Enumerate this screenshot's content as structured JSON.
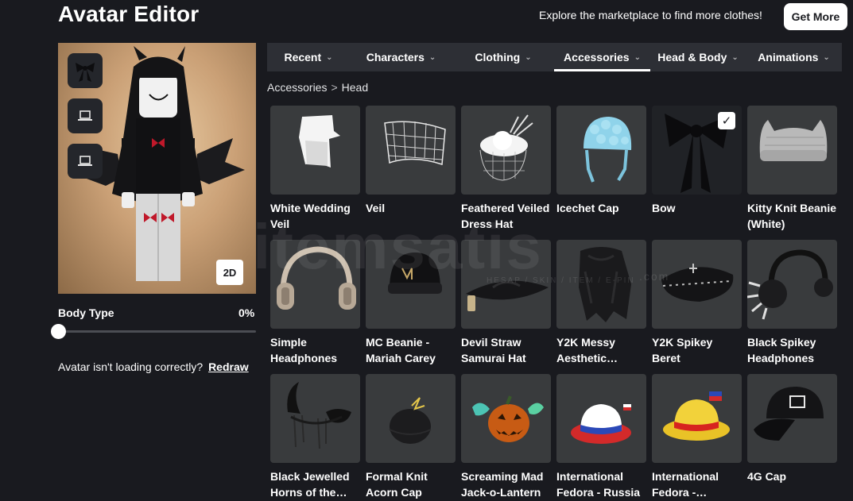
{
  "header": {
    "title": "Avatar Editor",
    "promo_text": "Explore the marketplace to find more clothes!",
    "get_more_label": "Get More"
  },
  "preview": {
    "toggle_2d_label": "2D",
    "thumb_icons": [
      "bow-icon",
      "laptop-icon",
      "laptop-icon"
    ]
  },
  "body_type": {
    "label": "Body Type",
    "value": "0%",
    "level": 0
  },
  "redraw": {
    "message": "Avatar isn't loading correctly?",
    "link": "Redraw"
  },
  "tabs": [
    {
      "label": "Recent",
      "active": false
    },
    {
      "label": "Characters",
      "active": false
    },
    {
      "label": "Clothing",
      "active": false
    },
    {
      "label": "Accessories",
      "active": true
    },
    {
      "label": "Head & Body",
      "active": false
    },
    {
      "label": "Animations",
      "active": false
    }
  ],
  "breadcrumb": {
    "parent": "Accessories",
    "separator": ">",
    "current": "Head"
  },
  "items": [
    {
      "name": "White Wedding Veil",
      "icon": "white-veil-icon",
      "selected": false
    },
    {
      "name": "Veil",
      "icon": "mesh-veil-icon",
      "selected": false
    },
    {
      "name": "Feathered Veiled Dress Hat",
      "icon": "feathered-hat-icon",
      "selected": false
    },
    {
      "name": "Icechet Cap",
      "icon": "ice-cap-icon",
      "selected": false
    },
    {
      "name": "Bow",
      "icon": "black-bow-icon",
      "selected": true
    },
    {
      "name": "Kitty Knit Beanie (White)",
      "icon": "kitty-beanie-icon",
      "selected": false
    },
    {
      "name": "Simple Headphones",
      "icon": "headphones-icon",
      "selected": false
    },
    {
      "name": "MC Beanie - Mariah Carey",
      "icon": "beanie-icon",
      "selected": false
    },
    {
      "name": "Devil Straw Samurai Hat",
      "icon": "straw-hat-icon",
      "selected": false
    },
    {
      "name": "Y2K Messy Aesthetic…",
      "icon": "messy-hair-icon",
      "selected": false
    },
    {
      "name": "Y2K Spikey Beret",
      "icon": "spikey-beret-icon",
      "selected": false
    },
    {
      "name": "Black Spikey Headphones",
      "icon": "spikey-headphones-icon",
      "selected": false
    },
    {
      "name": "Black Jewelled Horns of the…",
      "icon": "horns-icon",
      "selected": false
    },
    {
      "name": "Formal Knit Acorn Cap",
      "icon": "acorn-cap-icon",
      "selected": false
    },
    {
      "name": "Screaming Mad Jack-o-Lantern",
      "icon": "pumpkin-icon",
      "selected": false
    },
    {
      "name": "International Fedora - Russia",
      "icon": "fedora-russia-icon",
      "selected": false
    },
    {
      "name": "International Fedora -…",
      "icon": "fedora-philippines-icon",
      "selected": false
    },
    {
      "name": "4G Cap",
      "icon": "cap-icon",
      "selected": false
    }
  ],
  "watermark": {
    "text": "itemsatis",
    "sub": "HESAP / SKIN / ITEM / E-PIN",
    "domain": ".com"
  },
  "colors": {
    "background": "#191a1f",
    "card": "#393b3d",
    "tabs_bg": "#2d2f35",
    "accent": "#ffffff"
  }
}
